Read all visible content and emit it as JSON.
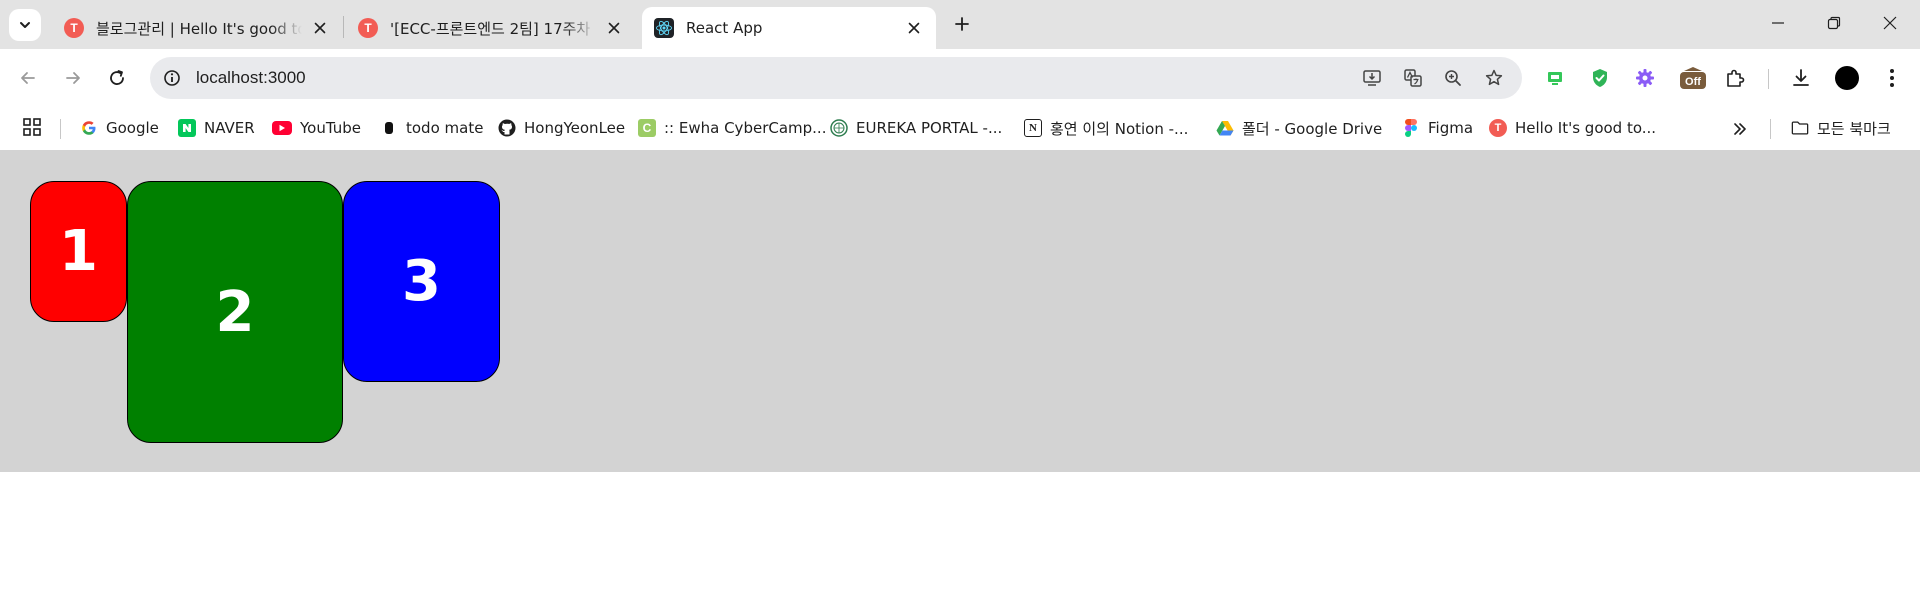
{
  "tabs": [
    {
      "title": "블로그관리 | Hello It's good to",
      "icon": "tistory-icon"
    },
    {
      "title": "'[ECC-프론트엔드 2팀] 17주차",
      "icon": "tistory-icon"
    },
    {
      "title": "React App",
      "icon": "react-icon"
    }
  ],
  "tistory_letter": "T",
  "address_bar": {
    "url": "localhost:3000"
  },
  "extension_badge": "Off",
  "bookmarks": [
    {
      "label": "Google"
    },
    {
      "label": "NAVER"
    },
    {
      "label": "YouTube"
    },
    {
      "label": "todo mate"
    },
    {
      "label": "HongYeonLee"
    },
    {
      "label": ":: Ewha CyberCamp..."
    },
    {
      "label": "EUREKA PORTAL -..."
    },
    {
      "label": "홍연 이의 Notion -..."
    },
    {
      "label": "폴더 - Google Drive"
    },
    {
      "label": "Figma"
    },
    {
      "label": "Hello It's good to..."
    }
  ],
  "all_bookmarks_label": "모든 북마크",
  "boxes": [
    {
      "label": "1",
      "color": "#ff0000"
    },
    {
      "label": "2",
      "color": "#008000"
    },
    {
      "label": "3",
      "color": "#0000ff"
    }
  ],
  "colors": {
    "page_bg": "#d3d3d3",
    "tab_strip": "#e3e3e3",
    "omnibox": "#e9eaed"
  }
}
